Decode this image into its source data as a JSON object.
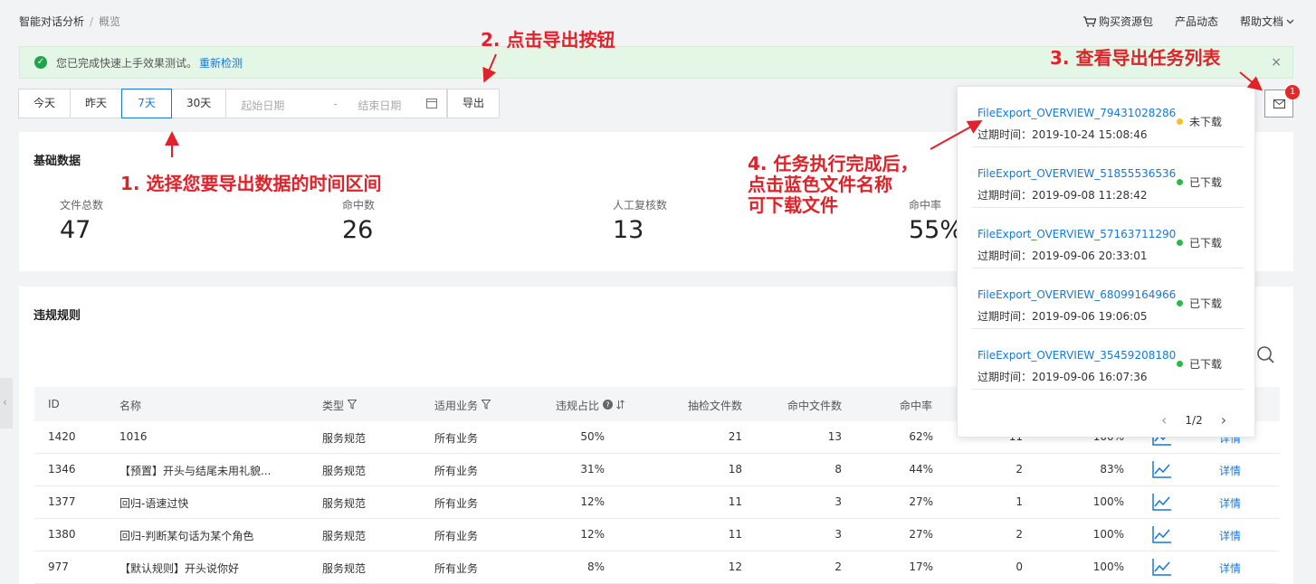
{
  "breadcrumb": {
    "root": "智能对话分析",
    "sep": "/",
    "current": "概览"
  },
  "topnav": {
    "buy": "购买资源包",
    "news": "产品动态",
    "help": "帮助文档"
  },
  "alert": {
    "message": "您已完成快速上手效果测试。",
    "link": "重新检测",
    "close": "×"
  },
  "datebar": {
    "today": "今天",
    "yesterday": "昨天",
    "d7": "7天",
    "d30": "30天",
    "start_placeholder": "起始日期",
    "dash": "-",
    "end_placeholder": "结束日期",
    "export": "导出"
  },
  "mail": {
    "badge": "1"
  },
  "basic": {
    "title": "基础数据",
    "stats": [
      {
        "label": "文件总数",
        "value": "47"
      },
      {
        "label": "命中数",
        "value": "26"
      },
      {
        "label": "人工复核数",
        "value": "13"
      },
      {
        "label": "命中率",
        "value": "55%"
      }
    ]
  },
  "rules": {
    "title": "违规规则",
    "headers": {
      "id": "ID",
      "name": "名称",
      "type": "类型",
      "biz": "适用业务",
      "ratio": "违规占比",
      "sampled": "抽检文件数",
      "hit_files": "命中文件数",
      "hit_rate": "命中率"
    },
    "rows": [
      {
        "id": "1420",
        "name": "1016",
        "type": "服务规范",
        "biz": "所有业务",
        "ratio": "50%",
        "sampled": "21",
        "hit": "13",
        "rate": "62%",
        "col9": "11",
        "col10": "100%",
        "detail": "详情"
      },
      {
        "id": "1346",
        "name": "【预置】开头与结尾未用礼貌...",
        "type": "服务规范",
        "biz": "所有业务",
        "ratio": "31%",
        "sampled": "18",
        "hit": "8",
        "rate": "44%",
        "col9": "2",
        "col10": "83%",
        "detail": "详情"
      },
      {
        "id": "1377",
        "name": "回归-语速过快",
        "type": "服务规范",
        "biz": "所有业务",
        "ratio": "12%",
        "sampled": "11",
        "hit": "3",
        "rate": "27%",
        "col9": "1",
        "col10": "100%",
        "detail": "详情"
      },
      {
        "id": "1380",
        "name": "回归-判断某句话为某个角色",
        "type": "服务规范",
        "biz": "所有业务",
        "ratio": "12%",
        "sampled": "11",
        "hit": "3",
        "rate": "27%",
        "col9": "2",
        "col10": "100%",
        "detail": "详情"
      },
      {
        "id": "977",
        "name": "【默认规则】开头说你好",
        "type": "服务规范",
        "biz": "所有业务",
        "ratio": "8%",
        "sampled": "12",
        "hit": "2",
        "rate": "17%",
        "col9": "0",
        "col10": "100%",
        "detail": "详情"
      }
    ]
  },
  "popup": {
    "expire_label": "过期时间：",
    "tasks": [
      {
        "name": "FileExport_OVERVIEW_79431028286...",
        "expire": "2019-10-24 15:08:46",
        "status": "未下载",
        "color": "#f5c02a"
      },
      {
        "name": "FileExport_OVERVIEW_51855536536...",
        "expire": "2019-09-08 11:28:42",
        "status": "已下载",
        "color": "#2db84d"
      },
      {
        "name": "FileExport_OVERVIEW_57163711290...",
        "expire": "2019-09-06 20:33:01",
        "status": "已下载",
        "color": "#2db84d"
      },
      {
        "name": "FileExport_OVERVIEW_68099164966...",
        "expire": "2019-09-06 19:06:05",
        "status": "已下载",
        "color": "#2db84d"
      },
      {
        "name": "FileExport_OVERVIEW_35459208180...",
        "expire": "2019-09-06 16:07:36",
        "status": "已下载",
        "color": "#2db84d"
      }
    ],
    "page": "1/2"
  },
  "annotations": {
    "a1": "1. 选择您要导出数据的时间区间",
    "a2": "2. 点击导出按钮",
    "a3": "3. 查看导出任务列表",
    "a4_line1": "4. 任务执行完成后，",
    "a4_line2": "点击蓝色文件名称",
    "a4_line3": "可下载文件"
  },
  "colors": {
    "accent": "#1678d8",
    "annotation": "#e0222a",
    "success": "#22a34a"
  }
}
